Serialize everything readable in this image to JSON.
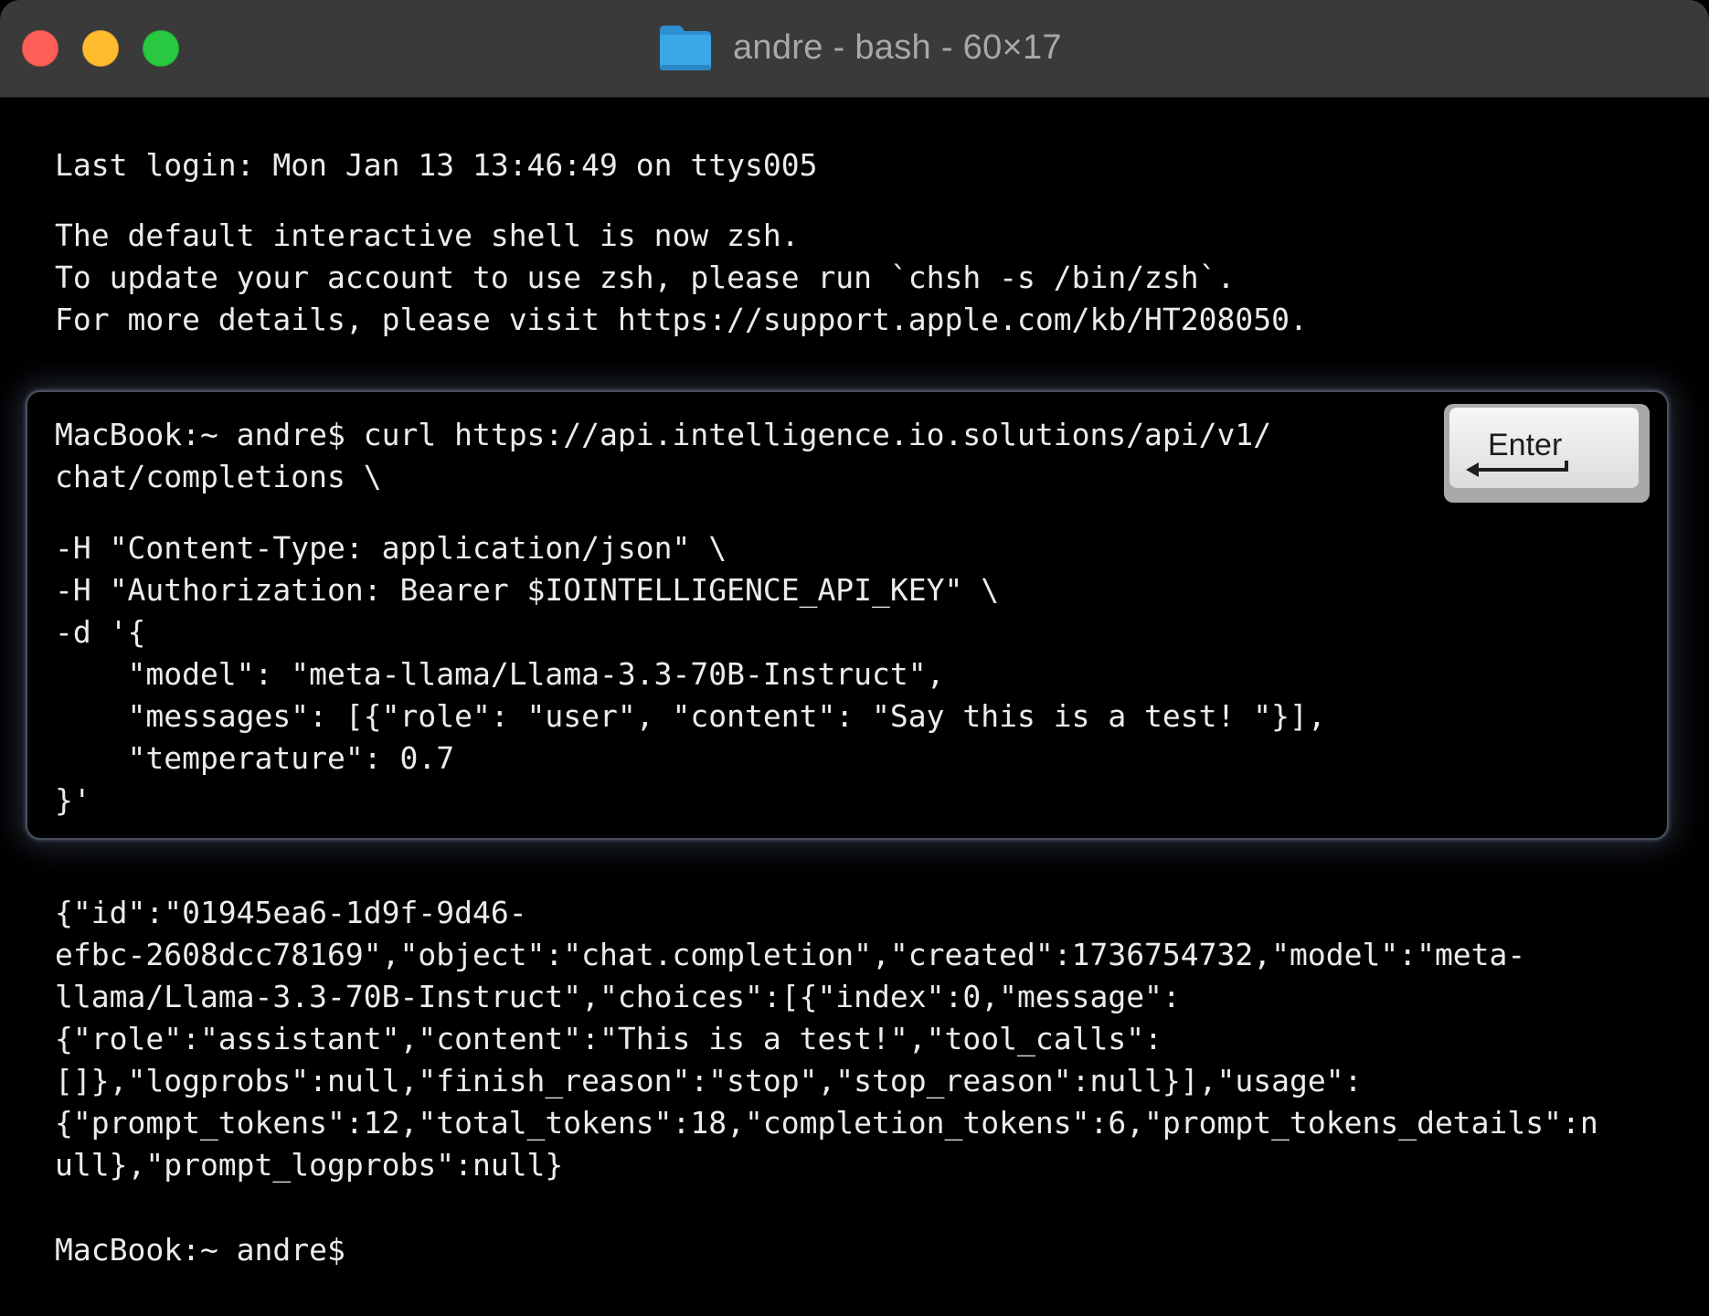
{
  "window": {
    "title": "andre - bash - 60×17"
  },
  "terminal": {
    "login_line": "Last login: Mon Jan 13 13:46:49 on ttys005",
    "notice_lines": [
      "The default interactive shell is now zsh.",
      "To update your account to use zsh, please run `chsh -s /bin/zsh`.",
      "For more details, please visit https://support.apple.com/kb/HT208050."
    ],
    "command_lines": [
      "MacBook:~ andre$ curl https://api.intelligence.io.solutions/api/v1/",
      "chat/completions \\"
    ],
    "command_args": [
      "-H \"Content-Type: application/json\" \\",
      "-H \"Authorization: Bearer $IOINTELLIGENCE_API_KEY\" \\",
      "-d '{",
      "    \"model\": \"meta-llama/Llama-3.3-70B-Instruct\",",
      "    \"messages\": [{\"role\": \"user\", \"content\": \"Say this is a test! \"}],",
      "    \"temperature\": 0.7",
      "}'"
    ],
    "response_lines": [
      "{\"id\":\"01945ea6-1d9f-9d46-",
      "efbc-2608dcc78169\",\"object\":\"chat.completion\",\"created\":1736754732,\"model\":\"meta-",
      "llama/Llama-3.3-70B-Instruct\",\"choices\":[{\"index\":0,\"message\":",
      "{\"role\":\"assistant\",\"content\":\"This is a test!\",\"tool_calls\":",
      "[]},\"logprobs\":null,\"finish_reason\":\"stop\",\"stop_reason\":null}],\"usage\":",
      "{\"prompt_tokens\":12,\"total_tokens\":18,\"completion_tokens\":6,\"prompt_tokens_details\":n",
      "ull},\"prompt_logprobs\":null}"
    ],
    "final_prompt": "MacBook:~ andre$"
  },
  "enter_key": {
    "label": "Enter",
    "icon": "return-arrow-icon"
  },
  "colors": {
    "titlebar": "#3a3a3a",
    "terminal_bg": "#000000",
    "text": "#ececec",
    "close": "#ff5f57",
    "minimize": "#febc2e",
    "zoom": "#28c840",
    "folder": "#3aa7e6",
    "highlight_glow": "#788cb9"
  }
}
